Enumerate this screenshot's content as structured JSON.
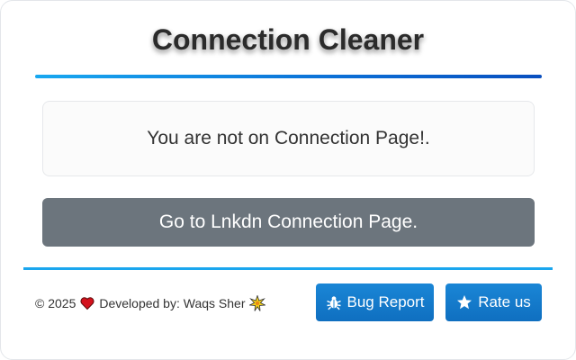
{
  "app": {
    "title": "Connection Cleaner"
  },
  "main": {
    "message": "You are not on Connection Page!.",
    "go_button_label": "Go to Lnkdn Connection Page."
  },
  "footer": {
    "year": "© 2025",
    "developed_by": "Developed by: Waqs Sher",
    "bug_report_label": "Bug Report",
    "rate_us_label": "Rate us"
  },
  "icons": {
    "heart": "heart-icon",
    "spark": "sparkle-icon",
    "bug": "bug-icon",
    "star": "star-icon"
  },
  "colors": {
    "accent": "#1aa6ee",
    "button_gray": "#6c757d",
    "button_blue": "#0f6fc0",
    "heart_red": "#d3121d"
  }
}
